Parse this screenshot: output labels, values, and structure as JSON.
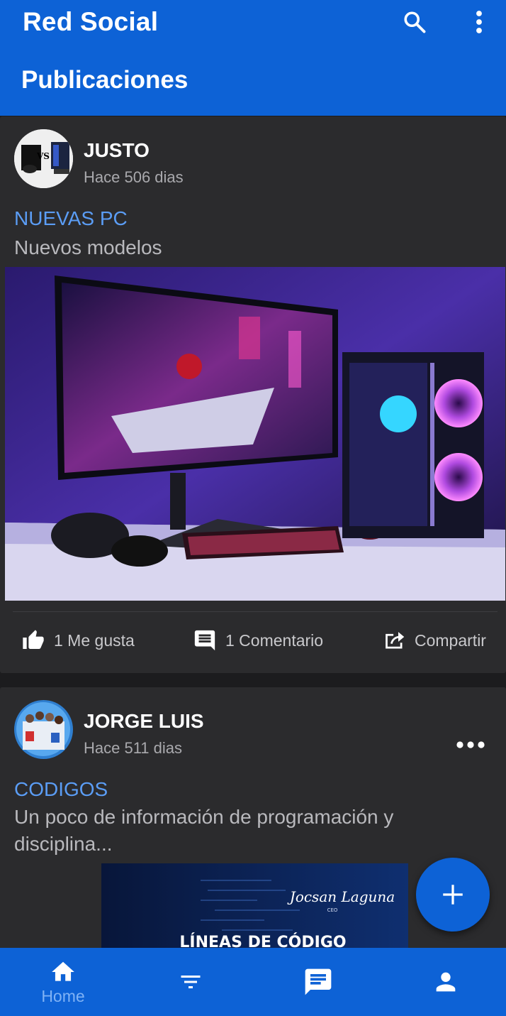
{
  "app": {
    "title": "Red Social",
    "section": "Publicaciones",
    "accent_color": "#0d62d6",
    "link_color": "#5b9df5"
  },
  "toolbar": {
    "icons": [
      "search-icon",
      "more-vert-icon"
    ]
  },
  "posts": [
    {
      "author": "JUSTO",
      "time": "Hace 506 dias",
      "title": "NUEVAS PC",
      "body": "Nuevos modelos",
      "image": "gaming-pc-setup",
      "avatar_text": "VS",
      "actions": {
        "like": "1 Me gusta",
        "comment": "1 Comentario",
        "share": "Compartir"
      }
    },
    {
      "author": "JORGE LUIS",
      "time": "Hace 511 dias",
      "title": "CODIGOS",
      "body": "Un poco de información de programación y disciplina...",
      "image": "code-lines-banner",
      "image_caption": "LÍNEAS DE CÓDIGO",
      "image_signature": "Jocsan Laguna",
      "image_signature_sub": "CEO"
    }
  ],
  "fab": {
    "icon": "plus-icon"
  },
  "bottom_nav": [
    {
      "icon": "home-icon",
      "label": "Home",
      "active": true
    },
    {
      "icon": "filter-icon"
    },
    {
      "icon": "chat-icon"
    },
    {
      "icon": "person-icon"
    }
  ]
}
